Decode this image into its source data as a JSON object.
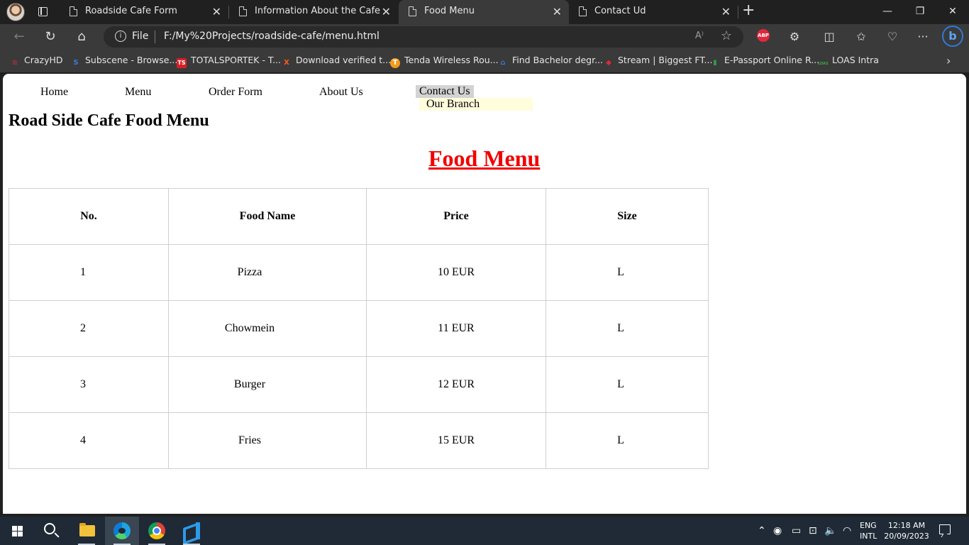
{
  "browser": {
    "tabs": [
      {
        "title": "Roadside Cafe Form",
        "active": false
      },
      {
        "title": "Information About the Cafe",
        "active": false
      },
      {
        "title": "Food Menu",
        "active": true
      },
      {
        "title": "Contact Ud",
        "active": false
      }
    ],
    "close_glyph": "✕",
    "new_tab_glyph": "+",
    "window_controls": {
      "minimize": "—",
      "restore": "❐",
      "close": "✕"
    },
    "address": {
      "scheme_label": "File",
      "url": "F:/My%20Projects/roadside-cafe/menu.html",
      "info_glyph": "i",
      "read_aloud": "A⁾",
      "favorite_glyph": "☆"
    },
    "nav": {
      "back": "←",
      "refresh": "↻",
      "home": "⌂"
    },
    "extensions": {
      "abp_label": "ABP",
      "bing_label": "b"
    },
    "toolbar_icons": {
      "extensions": "⚙",
      "split": "◫",
      "favorites": "✩",
      "health": "♡",
      "more": "···"
    },
    "bookmarks": [
      {
        "label": "CrazyHD",
        "icon": "crazyhd-icon",
        "glyph": "≋",
        "color": "#a8323e"
      },
      {
        "label": "Subscene - Browse...",
        "icon": "subscene-icon",
        "glyph": "S",
        "color": "#3b7bd1"
      },
      {
        "label": "TOTALSPORTEK - T...",
        "icon": "totalsportek-icon",
        "glyph": "TS",
        "color": "#d81f26"
      },
      {
        "label": "Download verified t...",
        "icon": "download-x-icon",
        "glyph": "X",
        "color": "#ff5a1f"
      },
      {
        "label": "Tenda Wireless Rou...",
        "icon": "tenda-icon",
        "glyph": "T",
        "color": "#f59b1a"
      },
      {
        "label": "Find Bachelor degr...",
        "icon": "university-icon",
        "glyph": "⌂",
        "color": "#3b7bd1"
      },
      {
        "label": "Stream | Biggest FT...",
        "icon": "stream-icon",
        "glyph": "◆",
        "color": "#e0283a"
      },
      {
        "label": "E-Passport Online R...",
        "icon": "passport-icon",
        "glyph": "▮",
        "color": "#2e9c4a"
      },
      {
        "label": "LOAS Intra",
        "icon": "loas-icon",
        "glyph": "LOAS",
        "color": "#3aa64a"
      }
    ],
    "bookmarks_more": "›"
  },
  "site": {
    "nav": [
      "Home",
      "Menu",
      "Order Form",
      "About Us",
      "Contact Us"
    ],
    "dropdown_item": "Our Branch",
    "heading": "Road Side Cafe Food Menu",
    "menu_title": "Food Menu",
    "table": {
      "headers": [
        "No.",
        "Food Name",
        "Price",
        "Size"
      ],
      "rows": [
        [
          "1",
          "Pizza",
          "10 EUR",
          "L"
        ],
        [
          "2",
          "Chowmein",
          "11 EUR",
          "L"
        ],
        [
          "3",
          "Burger",
          "12 EUR",
          "L"
        ],
        [
          "4",
          "Fries",
          "15 EUR",
          "L"
        ]
      ]
    }
  },
  "taskbar": {
    "language": "ENG",
    "layout": "INTL",
    "time": "12:18 AM",
    "date": "20/09/2023",
    "tray_glyphs": {
      "chevron": "⌃",
      "record": "◉",
      "battery": "▭",
      "device": "⊡",
      "volume": "🔈",
      "wifi": "◠"
    }
  },
  "colors": {
    "title_red": "#f20000",
    "dropdown_bg": "#fffddc",
    "hover_bg": "#d3d3d3"
  }
}
